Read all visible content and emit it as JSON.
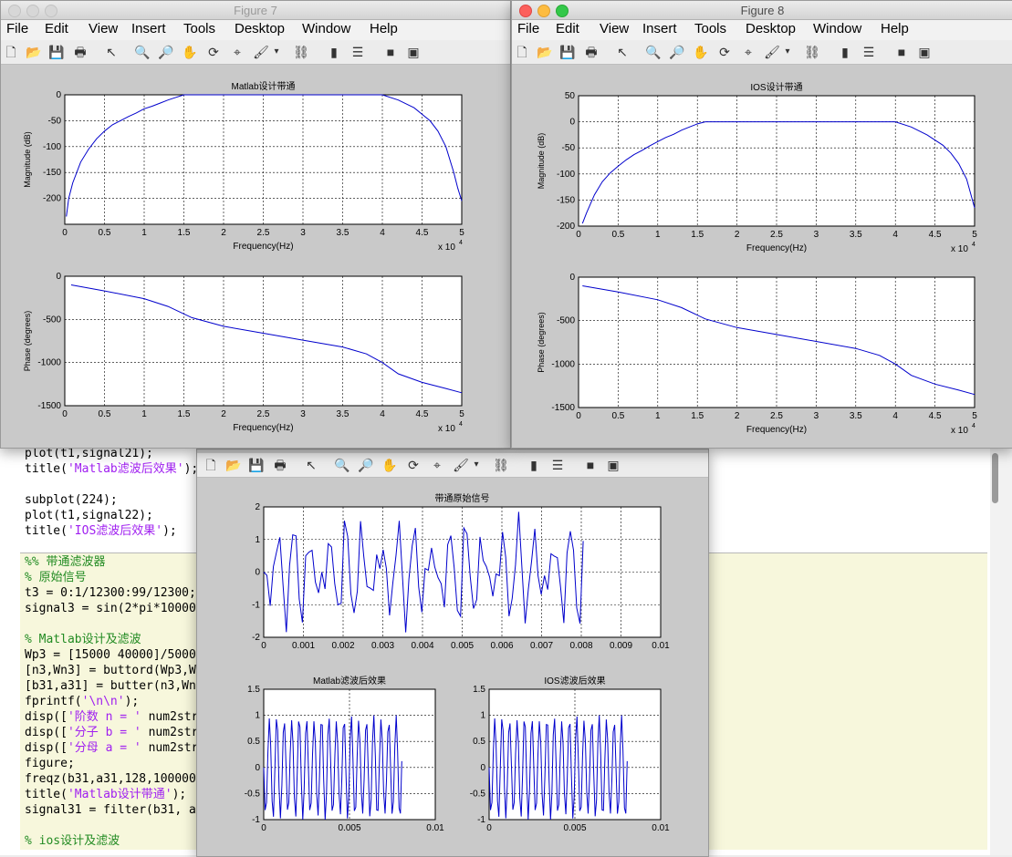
{
  "menu": [
    "File",
    "Edit",
    "View",
    "Insert",
    "Tools",
    "Desktop",
    "Window",
    "Help"
  ],
  "toolbar_icons": [
    "new-figure-icon",
    "open-file-icon",
    "save-icon",
    "print-icon",
    "pointer-icon",
    "zoom-in-icon",
    "zoom-out-icon",
    "pan-hand-icon",
    "rotate-3d-icon",
    "data-cursor-icon",
    "brush-icon",
    "dropdown-arrow-icon",
    "link-plot-icon",
    "colorbar-icon",
    "legend-icon",
    "hide-plot-tools-icon",
    "show-plot-tools-icon"
  ],
  "code": [
    {
      "segments": [
        {
          "t": "plot(t1,signal21);"
        }
      ]
    },
    {
      "segments": [
        {
          "t": "title("
        },
        {
          "t": "'Matlab滤波后效果'",
          "s": true
        },
        {
          "t": ");"
        }
      ]
    },
    {
      "segments": [
        {
          "t": ""
        }
      ]
    },
    {
      "segments": [
        {
          "t": "subplot(224);"
        }
      ]
    },
    {
      "segments": [
        {
          "t": "plot(t1,signal22);"
        }
      ]
    },
    {
      "segments": [
        {
          "t": "title("
        },
        {
          "t": "'IOS滤波后效果'",
          "s": true
        },
        {
          "t": ");"
        }
      ]
    },
    {
      "segments": [
        {
          "t": ""
        }
      ]
    },
    {
      "segments": [
        {
          "t": "%% 带通滤波器"
        }
      ],
      "comment": true
    },
    {
      "segments": [
        {
          "t": "% 原始信号"
        }
      ],
      "comment": true
    },
    {
      "segments": [
        {
          "t": "t3 = 0:1/12300:99/12300;"
        }
      ]
    },
    {
      "segments": [
        {
          "t": "signal3 = sin(2*pi*10000"
        }
      ]
    },
    {
      "segments": [
        {
          "t": ""
        }
      ]
    },
    {
      "segments": [
        {
          "t": "% Matlab设计及滤波"
        }
      ],
      "comment": true
    },
    {
      "segments": [
        {
          "t": "Wp3 = [15000 40000]/5000"
        }
      ]
    },
    {
      "segments": [
        {
          "t": "[n3,Wn3] = buttord(Wp3,W"
        }
      ]
    },
    {
      "segments": [
        {
          "t": "[b31,a31] = butter(n3,Wn"
        }
      ]
    },
    {
      "segments": [
        {
          "t": "fprintf("
        },
        {
          "t": "'\\n\\n'",
          "s": true
        },
        {
          "t": ");"
        }
      ]
    },
    {
      "segments": [
        {
          "t": "disp(["
        },
        {
          "t": "'阶数 n = '",
          "s": true
        },
        {
          "t": " num2str"
        }
      ]
    },
    {
      "segments": [
        {
          "t": "disp(["
        },
        {
          "t": "'分子 b = '",
          "s": true
        },
        {
          "t": " num2str"
        }
      ]
    },
    {
      "segments": [
        {
          "t": "disp(["
        },
        {
          "t": "'分母 a = '",
          "s": true
        },
        {
          "t": " num2str"
        }
      ]
    },
    {
      "segments": [
        {
          "t": "figure;"
        }
      ]
    },
    {
      "segments": [
        {
          "t": "freqz(b31,a31,128,100000"
        }
      ]
    },
    {
      "segments": [
        {
          "t": "title("
        },
        {
          "t": "'Matlab设计带通'",
          "s": true
        },
        {
          "t": ");"
        }
      ]
    },
    {
      "segments": [
        {
          "t": "signal31 = filter(b31, a"
        }
      ]
    },
    {
      "segments": [
        {
          "t": ""
        }
      ]
    },
    {
      "segments": [
        {
          "t": "% ios设计及滤波"
        }
      ],
      "comment": true
    }
  ],
  "figures": [
    {
      "id": "figure7",
      "title": "Figure 7",
      "active": false,
      "show_title": true,
      "show_menu": true,
      "axes": [
        {
          "title": "Matlab设计带通",
          "xlabel": "Frequency(Hz)",
          "ylabel": "Magnitude (dB)",
          "xlim": [
            0,
            5
          ],
          "ylim": [
            -250,
            0
          ],
          "xticks": [
            "0",
            "0.5",
            "1",
            "1.5",
            "2",
            "2.5",
            "3",
            "3.5",
            "4",
            "4.5",
            "5"
          ],
          "xtick_values": [
            0,
            0.5,
            1,
            1.5,
            2,
            2.5,
            3,
            3.5,
            4,
            4.5,
            5
          ],
          "yticks": [
            "0",
            "-50",
            "-100",
            "-150",
            "-200"
          ],
          "ytick_values": [
            0,
            -50,
            -100,
            -150,
            -200
          ],
          "exponent": "x 10",
          "exponent_power": "4",
          "x": [
            0.02,
            0.05,
            0.1,
            0.2,
            0.3,
            0.4,
            0.5,
            0.6,
            0.7,
            0.8,
            0.9,
            1.0,
            1.1,
            1.2,
            1.3,
            1.4,
            1.5,
            2.0,
            2.5,
            3.0,
            3.5,
            4.0,
            4.2,
            4.4,
            4.6,
            4.7,
            4.8,
            4.9,
            4.95,
            5.0
          ],
          "y": [
            -235,
            -200,
            -170,
            -130,
            -105,
            -85,
            -70,
            -58,
            -50,
            -42,
            -35,
            -27,
            -22,
            -16,
            -10,
            -5,
            0,
            0,
            0,
            0,
            0,
            0,
            -10,
            -25,
            -50,
            -70,
            -100,
            -150,
            -180,
            -205
          ]
        },
        {
          "title": "",
          "xlabel": "Frequency(Hz)",
          "ylabel": "Phase (degrees)",
          "xlim": [
            0,
            5
          ],
          "ylim": [
            -1500,
            0
          ],
          "xticks": [
            "0",
            "0.5",
            "1",
            "1.5",
            "2",
            "2.5",
            "3",
            "3.5",
            "4",
            "4.5",
            "5"
          ],
          "xtick_values": [
            0,
            0.5,
            1,
            1.5,
            2,
            2.5,
            3,
            3.5,
            4,
            4.5,
            5
          ],
          "yticks": [
            "0",
            "-500",
            "-1000",
            "-1500"
          ],
          "ytick_values": [
            0,
            -500,
            -1000,
            -1500
          ],
          "exponent": "x 10",
          "exponent_power": "4",
          "x": [
            0.08,
            0.5,
            1.0,
            1.3,
            1.6,
            2.0,
            2.5,
            3.0,
            3.5,
            3.8,
            4.0,
            4.2,
            4.5,
            4.8,
            5.0
          ],
          "y": [
            -100,
            -170,
            -260,
            -350,
            -480,
            -580,
            -660,
            -740,
            -820,
            -900,
            -1000,
            -1130,
            -1230,
            -1300,
            -1350
          ]
        }
      ]
    },
    {
      "id": "figure8",
      "title": "Figure 8",
      "active": true,
      "show_title": true,
      "show_menu": true,
      "axes": [
        {
          "title": "IOS设计带通",
          "xlabel": "Frequency(Hz)",
          "ylabel": "Magnitude (dB)",
          "xlim": [
            0,
            5
          ],
          "ylim": [
            -200,
            50
          ],
          "xticks": [
            "0",
            "0.5",
            "1",
            "1.5",
            "2",
            "2.5",
            "3",
            "3.5",
            "4",
            "4.5",
            "5"
          ],
          "xtick_values": [
            0,
            0.5,
            1,
            1.5,
            2,
            2.5,
            3,
            3.5,
            4,
            4.5,
            5
          ],
          "yticks": [
            "50",
            "0",
            "-50",
            "-100",
            "-150",
            "-200"
          ],
          "ytick_values": [
            50,
            0,
            -50,
            -100,
            -150,
            -200
          ],
          "exponent": "x 10",
          "exponent_power": "4",
          "x": [
            0.05,
            0.1,
            0.2,
            0.3,
            0.4,
            0.5,
            0.6,
            0.7,
            0.8,
            0.9,
            1.0,
            1.1,
            1.2,
            1.3,
            1.4,
            1.5,
            1.6,
            2.0,
            2.5,
            3.0,
            3.5,
            4.0,
            4.2,
            4.4,
            4.6,
            4.7,
            4.8,
            4.9,
            5.0
          ],
          "y": [
            -195,
            -175,
            -140,
            -115,
            -98,
            -85,
            -73,
            -63,
            -55,
            -46,
            -38,
            -30,
            -24,
            -16,
            -10,
            -4,
            0,
            0,
            0,
            0,
            0,
            0,
            -10,
            -25,
            -45,
            -60,
            -80,
            -110,
            -165
          ]
        },
        {
          "title": "",
          "xlabel": "Frequency(Hz)",
          "ylabel": "Phase (degrees)",
          "xlim": [
            0,
            5
          ],
          "ylim": [
            -1500,
            0
          ],
          "xticks": [
            "0",
            "0.5",
            "1",
            "1.5",
            "2",
            "2.5",
            "3",
            "3.5",
            "4",
            "4.5",
            "5"
          ],
          "xtick_values": [
            0,
            0.5,
            1,
            1.5,
            2,
            2.5,
            3,
            3.5,
            4,
            4.5,
            5
          ],
          "yticks": [
            "0",
            "-500",
            "-1000",
            "-1500"
          ],
          "ytick_values": [
            0,
            -500,
            -1000,
            -1500
          ],
          "exponent": "x 10",
          "exponent_power": "4",
          "x": [
            0.05,
            0.5,
            1.0,
            1.3,
            1.6,
            2.0,
            2.5,
            3.0,
            3.5,
            3.8,
            4.0,
            4.2,
            4.5,
            4.8,
            5.0
          ],
          "y": [
            -100,
            -170,
            -260,
            -350,
            -480,
            -580,
            -660,
            -740,
            -820,
            -900,
            -1000,
            -1130,
            -1230,
            -1300,
            -1350
          ]
        }
      ]
    },
    {
      "id": "figure-signal",
      "title": "",
      "active": false,
      "show_title": false,
      "show_menu": false,
      "axes": [
        {
          "title": "带通原始信号",
          "xlabel": "",
          "ylabel": "",
          "xlim": [
            0,
            0.01
          ],
          "ylim": [
            -2,
            2
          ],
          "xticks": [
            "0",
            "0.001",
            "0.002",
            "0.003",
            "0.004",
            "0.005",
            "0.006",
            "0.007",
            "0.008",
            "0.009",
            "0.01"
          ],
          "xtick_values": [
            0,
            0.001,
            0.002,
            0.003,
            0.004,
            0.005,
            0.006,
            0.007,
            0.008,
            0.009,
            0.01
          ],
          "yticks": [
            "2",
            "1",
            "0",
            "-1",
            "-2"
          ],
          "ytick_values": [
            2,
            1,
            0,
            -1,
            -2
          ],
          "signal": {
            "n": 100,
            "fs": 12300,
            "comps": [
              {
                "a": 1,
                "f": 10000
              },
              {
                "a": 0.6,
                "f": 3000
              },
              {
                "a": 0.4,
                "f": 5000
              }
            ]
          }
        },
        {
          "title": "Matlab滤波后效果",
          "xlabel": "",
          "ylabel": "",
          "xlim": [
            0,
            0.01
          ],
          "ylim": [
            -1,
            1.5
          ],
          "xticks": [
            "0",
            "0.005",
            "0.01"
          ],
          "xtick_values": [
            0,
            0.005,
            0.01
          ],
          "yticks": [
            "1.5",
            "1",
            "0.5",
            "0",
            "-0.5",
            "-1"
          ],
          "ytick_values": [
            1.5,
            1,
            0.5,
            0,
            -0.5,
            -1
          ],
          "signal": {
            "n": 100,
            "fs": 12300,
            "comps": [
              {
                "a": 0.95,
                "f": 10000
              },
              {
                "a": 0.06,
                "f": 3000
              }
            ]
          }
        },
        {
          "title": "IOS滤波后效果",
          "xlabel": "",
          "ylabel": "",
          "xlim": [
            0,
            0.01
          ],
          "ylim": [
            -1,
            1.5
          ],
          "xticks": [
            "0",
            "0.005",
            "0.01"
          ],
          "xtick_values": [
            0,
            0.005,
            0.01
          ],
          "yticks": [
            "1.5",
            "1",
            "0.5",
            "0",
            "-0.5",
            "-1"
          ],
          "ytick_values": [
            1.5,
            1,
            0.5,
            0,
            -0.5,
            -1
          ],
          "signal": {
            "n": 100,
            "fs": 12300,
            "comps": [
              {
                "a": 0.95,
                "f": 10000
              },
              {
                "a": 0.06,
                "f": 3000
              }
            ]
          }
        }
      ]
    }
  ],
  "colors": {
    "line": "#0000cc",
    "axes_bg": "#ffffff",
    "figure_bg": "#c9c9c9",
    "comment": "#228b22",
    "string": "#a020f0"
  }
}
